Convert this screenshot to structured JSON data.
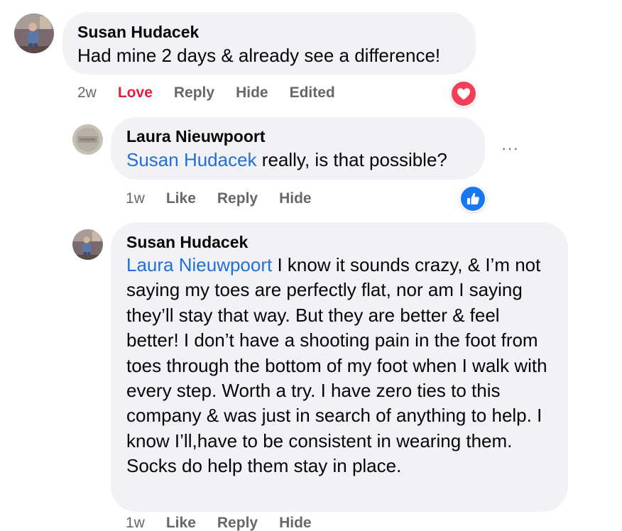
{
  "comments": [
    {
      "author": "Susan Hudacek",
      "text": "Had mine 2 days & already see a difference!",
      "time": "2w",
      "actions": [
        "Love",
        "Reply",
        "Hide",
        "Edited"
      ],
      "reaction": "heart-icon",
      "reaction_color": "#f33e58"
    },
    {
      "author": "Laura Nieuwpoort",
      "mention": "Susan Hudacek",
      "text": " really, is that possible?",
      "time": "1w",
      "actions": [
        "Like",
        "Reply",
        "Hide"
      ],
      "reaction": "thumbs-up-icon",
      "reaction_color": "#1877f2",
      "more_label": "···"
    },
    {
      "author": "Susan Hudacek",
      "mention": "Laura Nieuwpoort",
      "text": " I know it sounds crazy, & I’m not saying my toes are perfectly flat, nor am I saying they’ll stay that way. But they are better & feel better! I don’t have a shooting pain in the foot from toes through the bottom of my foot when I walk with every step. Worth a try. I have zero ties to this company & was just in search of anything to help. I know I’ll,have to be consistent in wearing them. Socks do help them stay in place.",
      "time": "1w",
      "actions": [
        "Like",
        "Reply",
        "Hide"
      ]
    }
  ],
  "colors": {
    "mention": "#216fdb",
    "love": "#e41e3f",
    "meta": "#65676b",
    "bubble": "#f0f2f5"
  }
}
